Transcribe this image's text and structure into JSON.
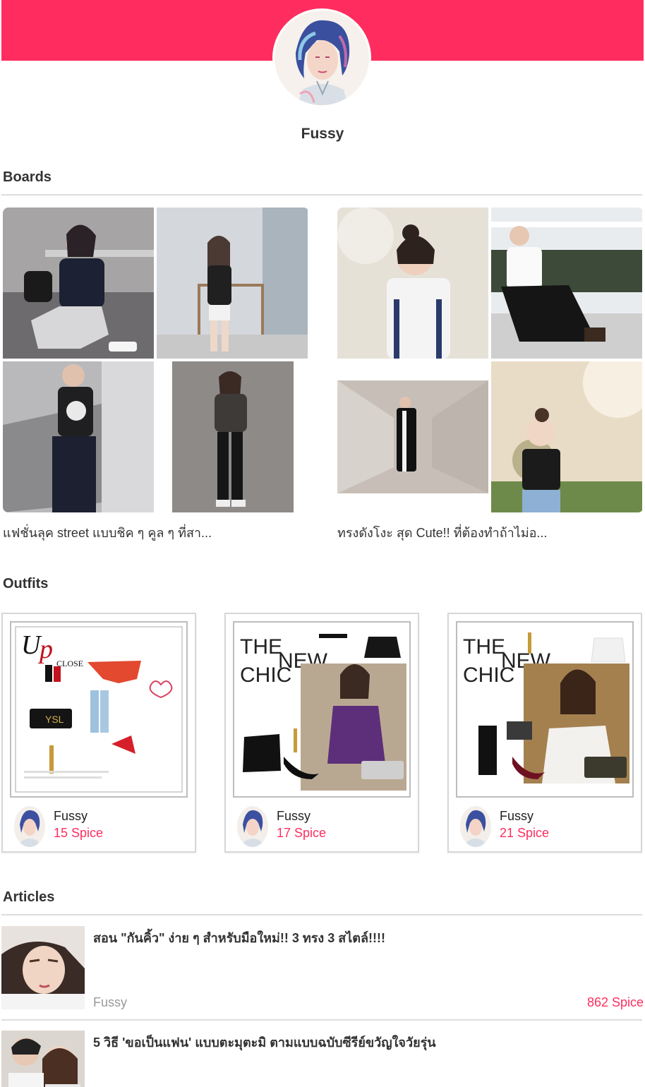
{
  "profile": {
    "name": "Fussy",
    "accent_color": "#ff2d5f"
  },
  "sections": {
    "boards": "Boards",
    "outfits": "Outfits",
    "articles": "Articles"
  },
  "boards": [
    {
      "caption": "แฟชั่นลุค street แบบชิค ๆ คูล ๆ ที่สา..."
    },
    {
      "caption": "ทรงดังโงะ สุด Cute!! ที่ต้องทำถ้าไม่อ..."
    }
  ],
  "outfits": [
    {
      "user": "Fussy",
      "spice": "15 Spice"
    },
    {
      "user": "Fussy",
      "spice": "17 Spice"
    },
    {
      "user": "Fussy",
      "spice": "21 Spice"
    }
  ],
  "articles": [
    {
      "title": "สอน \"กันคิ้ว\" ง่าย ๆ สำหรับมือใหม่!! 3 ทรง 3 สไตล์!!!!",
      "author": "Fussy",
      "spice": "862 Spice"
    },
    {
      "title": "5 วิธี 'ขอเป็นแฟน' แบบตะมุตะมิ ตามแบบฉบับซีรีย์ขวัญใจวัยรุ่น",
      "author": "",
      "spice": ""
    }
  ]
}
